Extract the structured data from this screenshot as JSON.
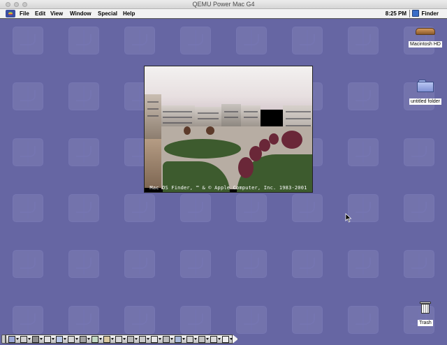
{
  "host_window": {
    "title": "QEMU Power Mac G4"
  },
  "menubar": {
    "items": [
      "File",
      "Edit",
      "View",
      "Window",
      "Special",
      "Help"
    ],
    "clock": "8:25 PM",
    "active_app": "Finder"
  },
  "splash": {
    "caption": "Mac OS Finder, ™ & © Apple Computer, Inc. 1983-2001"
  },
  "desktop_icons": {
    "hd": "Macintosh HD",
    "folder": "untitled folder",
    "trash": "Trash"
  },
  "control_strip": {
    "modules": [
      "control-strip-toggle",
      "monitor-icon",
      "appletalk-icon",
      "file-sharing-icon",
      "sound-icon",
      "location-icon",
      "remote-access-icon",
      "web-sharing-icon",
      "keychain-icon",
      "printer-icon",
      "monitor-bitdepth-icon",
      "monitor-resolution-icon",
      "cd-icon",
      "speaker-volume-icon",
      "energy-icon",
      "desktop-printer-icon",
      "keyboard-icon",
      "port-icon",
      "chevron-icon"
    ]
  },
  "colors": {
    "desktop": "#6666a3",
    "menubar": "#f2f2f2",
    "accent": "#3b4ea0"
  }
}
